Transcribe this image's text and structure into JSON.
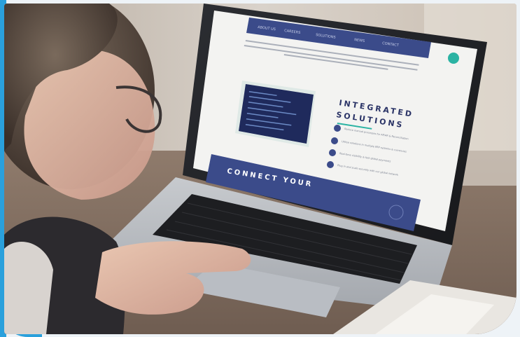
{
  "scene": {
    "description_tags": [
      "woman",
      "laptop",
      "desk",
      "hand-on-keyboard"
    ],
    "accent_color": "#2aa0dc",
    "screen_brand_color": "#3b4b8a",
    "chat_button_color": "#2bb3a3"
  },
  "laptop_screen": {
    "nav_items": [
      "ABOUT US",
      "CAREERS",
      "SOLUTIONS",
      "NEWS",
      "CONTACT"
    ],
    "intro_text": "The TransferMate technology platform is an end-to-end cloud-based solution that simplifies, digitises and automates the manual tasks involved in paying and getting paid. Integrate our global payments network directly into your business and unlock your organisation's growth.",
    "heading_line1": "INTEGRATED",
    "heading_line2": "SOLUTIONS",
    "features": [
      "Reduce manual processes for AP/AR & Reconciliation",
      "Utilise solutions in multiple ERP systems & currencies",
      "Real-time visibility & fast global payments",
      "Plug in and scale securely with our global network"
    ],
    "banner_text": "CONNECT YOUR"
  }
}
